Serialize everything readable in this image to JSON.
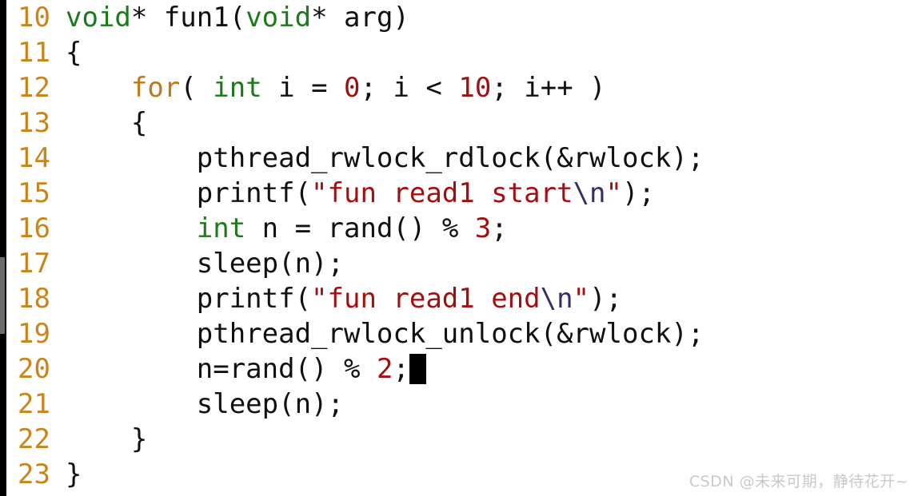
{
  "editor": {
    "language": "c",
    "background_color": "#ffffff",
    "line_number_color": "#c8851a",
    "text_color": "#111111",
    "keyword_color": "#1a7a1a",
    "control_keyword_color": "#c07818",
    "number_color": "#a01010",
    "string_color": "#a01010",
    "escape_color": "#3a2a6a",
    "cursor_color": "#000000",
    "first_line_number": 10,
    "last_line_number": 23
  },
  "gutter": {
    "numbers": [
      "10",
      "11",
      "12",
      "13",
      "14",
      "15",
      "16",
      "17",
      "18",
      "19",
      "20",
      "21",
      "22",
      "23"
    ]
  },
  "lines": [
    {
      "number": "10",
      "plain": "void* fun1(void* arg)",
      "tokens": [
        {
          "t": "void",
          "c": "kw"
        },
        {
          "t": "* fun1(",
          "c": "plain"
        },
        {
          "t": "void",
          "c": "kw"
        },
        {
          "t": "* arg)",
          "c": "plain"
        }
      ]
    },
    {
      "number": "11",
      "plain": "{",
      "tokens": [
        {
          "t": "{",
          "c": "plain"
        }
      ]
    },
    {
      "number": "12",
      "plain": "    for( int i = 0; i < 10; i++ )",
      "tokens": [
        {
          "t": "    ",
          "c": "plain"
        },
        {
          "t": "for",
          "c": "ctrl"
        },
        {
          "t": "( ",
          "c": "plain"
        },
        {
          "t": "int",
          "c": "kw"
        },
        {
          "t": " i = ",
          "c": "plain"
        },
        {
          "t": "0",
          "c": "num"
        },
        {
          "t": "; i < ",
          "c": "plain"
        },
        {
          "t": "10",
          "c": "num"
        },
        {
          "t": "; i++ )",
          "c": "plain"
        }
      ]
    },
    {
      "number": "13",
      "plain": "    {",
      "tokens": [
        {
          "t": "    {",
          "c": "plain"
        }
      ]
    },
    {
      "number": "14",
      "plain": "        pthread_rwlock_rdlock(&rwlock);",
      "tokens": [
        {
          "t": "        pthread_rwlock_rdlock(&rwlock);",
          "c": "plain"
        }
      ]
    },
    {
      "number": "15",
      "plain": "        printf(\"fun read1 start\\n\");",
      "tokens": [
        {
          "t": "        printf(",
          "c": "plain"
        },
        {
          "t": "\"fun read1 start",
          "c": "str"
        },
        {
          "t": "\\n",
          "c": "esc"
        },
        {
          "t": "\"",
          "c": "str"
        },
        {
          "t": ");",
          "c": "plain"
        }
      ]
    },
    {
      "number": "16",
      "plain": "        int n = rand() % 3;",
      "tokens": [
        {
          "t": "        ",
          "c": "plain"
        },
        {
          "t": "int",
          "c": "kw"
        },
        {
          "t": " n = rand() % ",
          "c": "plain"
        },
        {
          "t": "3",
          "c": "num"
        },
        {
          "t": ";",
          "c": "plain"
        }
      ]
    },
    {
      "number": "17",
      "plain": "        sleep(n);",
      "tokens": [
        {
          "t": "        sleep(n);",
          "c": "plain"
        }
      ]
    },
    {
      "number": "18",
      "plain": "        printf(\"fun read1 end\\n\");",
      "tokens": [
        {
          "t": "        printf(",
          "c": "plain"
        },
        {
          "t": "\"fun read1 end",
          "c": "str"
        },
        {
          "t": "\\n",
          "c": "esc"
        },
        {
          "t": "\"",
          "c": "str"
        },
        {
          "t": ");",
          "c": "plain"
        }
      ]
    },
    {
      "number": "19",
      "plain": "        pthread_rwlock_unlock(&rwlock);",
      "tokens": [
        {
          "t": "        pthread_rwlock_unlock(&rwlock);",
          "c": "plain"
        }
      ]
    },
    {
      "number": "20",
      "plain": "        n=rand() % 2;",
      "tokens": [
        {
          "t": "        n=rand() % ",
          "c": "plain"
        },
        {
          "t": "2",
          "c": "num"
        },
        {
          "t": ";",
          "c": "plain"
        }
      ],
      "cursor_after": true
    },
    {
      "number": "21",
      "plain": "        sleep(n);",
      "tokens": [
        {
          "t": "        sleep(n);",
          "c": "plain"
        }
      ]
    },
    {
      "number": "22",
      "plain": "    }",
      "tokens": [
        {
          "t": "    }",
          "c": "plain"
        }
      ]
    },
    {
      "number": "23",
      "plain": "}",
      "tokens": [
        {
          "t": "}",
          "c": "plain"
        }
      ]
    }
  ],
  "watermark": {
    "text": "CSDN @未来可期，静待花开~",
    "color": "#c9c9c9"
  }
}
